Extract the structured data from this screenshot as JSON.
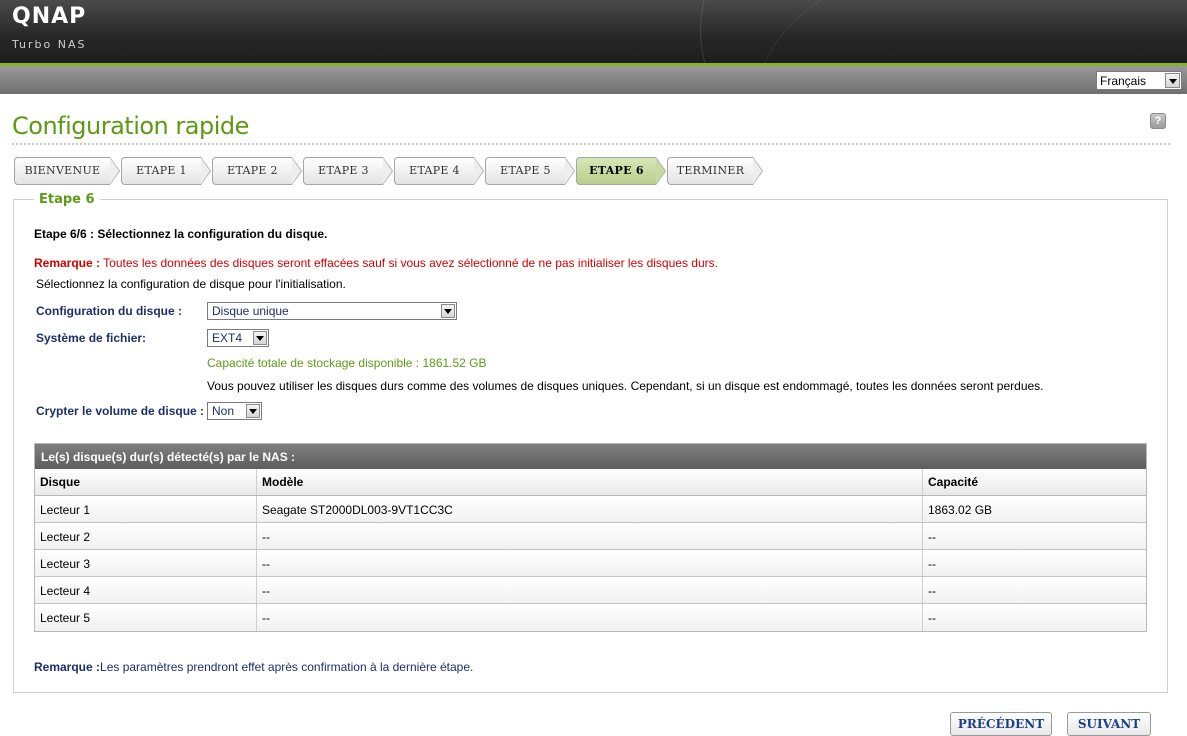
{
  "brand": {
    "logo": "QNAP",
    "tagline": "Turbo NAS"
  },
  "language": {
    "selected": "Français"
  },
  "page": {
    "title": "Configuration rapide",
    "help": "?"
  },
  "steps": [
    {
      "label": "BIENVENUE"
    },
    {
      "label": "ETAPE 1"
    },
    {
      "label": "ETAPE 2"
    },
    {
      "label": "ETAPE 3"
    },
    {
      "label": "ETAPE 4"
    },
    {
      "label": "ETAPE 5"
    },
    {
      "label": "ETAPE 6"
    },
    {
      "label": "TERMINER"
    }
  ],
  "active_step": "ETAPE 6",
  "panel": {
    "legend": "Etape 6",
    "heading": "Etape 6/6 : Sélectionnez la configuration du disque.",
    "warning_label": "Remarque :",
    "warning_text": " Toutes les données des disques seront effacées sauf si vous avez sélectionné de ne pas initialiser les disques durs.",
    "instruction": "Sélectionnez la configuration de disque pour l'initialisation.",
    "disk_config_label": "Configuration du disque :",
    "disk_config_value": "Disque unique",
    "fs_label": "Système de fichier:",
    "fs_value": "EXT4",
    "capacity_text": "Capacité totale de stockage disponible : 1861.52 GB",
    "info_text": "Vous pouvez utiliser les disques durs comme des volumes de disques uniques. Cependant, si un disque est endommagé, toutes les données seront perdues.",
    "encrypt_label": "Crypter le volume de disque :",
    "encrypt_value": "Non"
  },
  "table": {
    "title": "Le(s) disque(s) dur(s) détecté(s) par le NAS :",
    "headers": [
      "Disque",
      "Modèle",
      "Capacité"
    ],
    "rows": [
      [
        "Lecteur 1",
        "Seagate ST2000DL003-9VT1CC3C",
        "1863.02 GB"
      ],
      [
        "Lecteur 2",
        "--",
        "--"
      ],
      [
        "Lecteur 3",
        "--",
        "--"
      ],
      [
        "Lecteur 4",
        "--",
        "--"
      ],
      [
        "Lecteur 5",
        "--",
        "--"
      ]
    ]
  },
  "footer_note": {
    "label": "Remarque :",
    "text": "Les paramètres prendront effet après confirmation à la dernière étape."
  },
  "buttons": {
    "prev": "PRÉCÉDENT",
    "next": "SUIVANT"
  },
  "colors": {
    "brand_green": "#5e9a16",
    "accent_line": "#86b52c",
    "warning_red": "#d10000",
    "label_navy": "#1d2e6b"
  }
}
